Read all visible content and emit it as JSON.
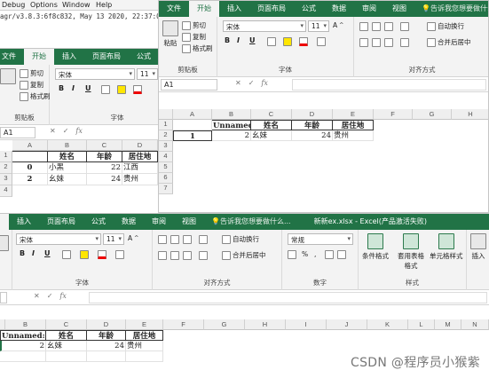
{
  "console": {
    "menus": [
      "Debug",
      "Options",
      "Window",
      "Help"
    ],
    "version": "agr/v3.8.3:6f8c832, May 13 2020, 22:37:02"
  },
  "excel": {
    "tabs_short": [
      "文件",
      "开始",
      "插入",
      "页面布局",
      "公式"
    ],
    "tabs_full": [
      "文件",
      "开始",
      "插入",
      "页面布局",
      "公式",
      "数据",
      "审阅",
      "视图"
    ],
    "tell_me": "告诉我您想要做什么...",
    "tell_me_short": "告诉我您想要做什么...",
    "clipboard": {
      "cut": "剪切",
      "copy": "复制",
      "format_painter": "格式刷",
      "paste": "粘贴",
      "label": "剪贴板"
    },
    "font": {
      "name": "宋体",
      "size": "11",
      "label": "字体",
      "bold": "B",
      "italic": "I",
      "underline": "U"
    },
    "align": {
      "wrap": "自动换行",
      "merge": "合并后居中",
      "label": "对齐方式"
    },
    "number": {
      "format": "常规",
      "label": "数字"
    },
    "styles": {
      "conditional": "条件格式",
      "table": "套用表格格式",
      "cell": "单元格样式",
      "label": "样式"
    },
    "insert": "插入",
    "namebox": "A1",
    "fx": "fx",
    "doc_title": "新新ex.xlsx - Excel(产品激活失败)"
  },
  "sheets": {
    "cols": [
      "A",
      "B",
      "C",
      "D",
      "E",
      "F",
      "G",
      "H",
      "I",
      "J",
      "K",
      "L",
      "M",
      "N"
    ],
    "rows": [
      "1",
      "2",
      "3",
      "4",
      "5",
      "6",
      "7"
    ],
    "sheet_a": {
      "header": [
        "",
        "姓名",
        "年龄",
        "居住地"
      ],
      "row1": [
        "0",
        "小黑",
        "22",
        "江西"
      ],
      "row2": [
        "2",
        "幺妹",
        "24",
        "贵州"
      ]
    },
    "sheet_b": {
      "header": [
        "Unnamed:",
        "姓名",
        "年龄",
        "居住地"
      ],
      "row1": [
        "1",
        "2",
        "幺妹",
        "24",
        "贵州"
      ]
    },
    "sheet_c": {
      "header": [
        "Unnamed:",
        "姓名",
        "年龄",
        "居住地"
      ],
      "row1": [
        "2",
        "幺妹",
        "24",
        "贵州"
      ]
    }
  },
  "watermark": "CSDN @程序员小猴紫"
}
